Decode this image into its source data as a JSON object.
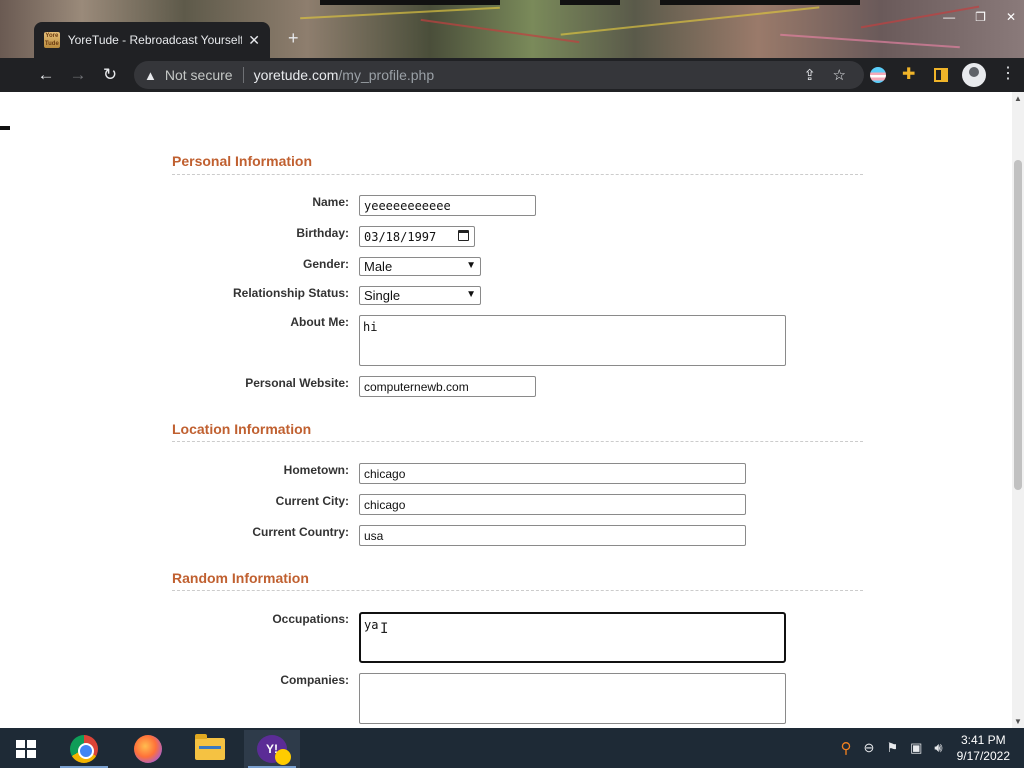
{
  "browser": {
    "tab_title": "YoreTude - Rebroadcast Yourself.",
    "tab_close": "✕",
    "favicon_text": "Yore Tude",
    "new_tab": "+",
    "security_label": "Not secure",
    "url_host": "yoretude.com",
    "url_path": "/my_profile.php",
    "window_controls": {
      "minimize": "—",
      "maximize": "❐",
      "close": "✕"
    }
  },
  "sections": {
    "personal": "Personal Information",
    "location": "Location Information",
    "random": "Random Information"
  },
  "fields": {
    "name": {
      "label": "Name:",
      "value": "yeeeeeeeeeee"
    },
    "birthday": {
      "label": "Birthday:",
      "value": "03/18/1997"
    },
    "gender": {
      "label": "Gender:",
      "value": "Male"
    },
    "relationship": {
      "label": "Relationship Status:",
      "value": "Single"
    },
    "about": {
      "label": "About Me:",
      "value": "hi"
    },
    "website": {
      "label": "Personal Website:",
      "value": "computernewb.com"
    },
    "hometown": {
      "label": "Hometown:",
      "value": "chicago"
    },
    "city": {
      "label": "Current City:",
      "value": "chicago"
    },
    "country": {
      "label": "Current Country:",
      "value": "usa"
    },
    "occupations": {
      "label": "Occupations:",
      "value": "ya"
    },
    "companies": {
      "label": "Companies:",
      "value": ""
    }
  },
  "taskbar": {
    "time": "3:41 PM",
    "date": "9/17/2022",
    "apps": [
      "chrome",
      "firefox",
      "file-explorer",
      "yahoo-messenger"
    ]
  },
  "colors": {
    "section_title": "#c06030",
    "browser_chrome": "#202124",
    "taskbar": "#1e2a36"
  }
}
